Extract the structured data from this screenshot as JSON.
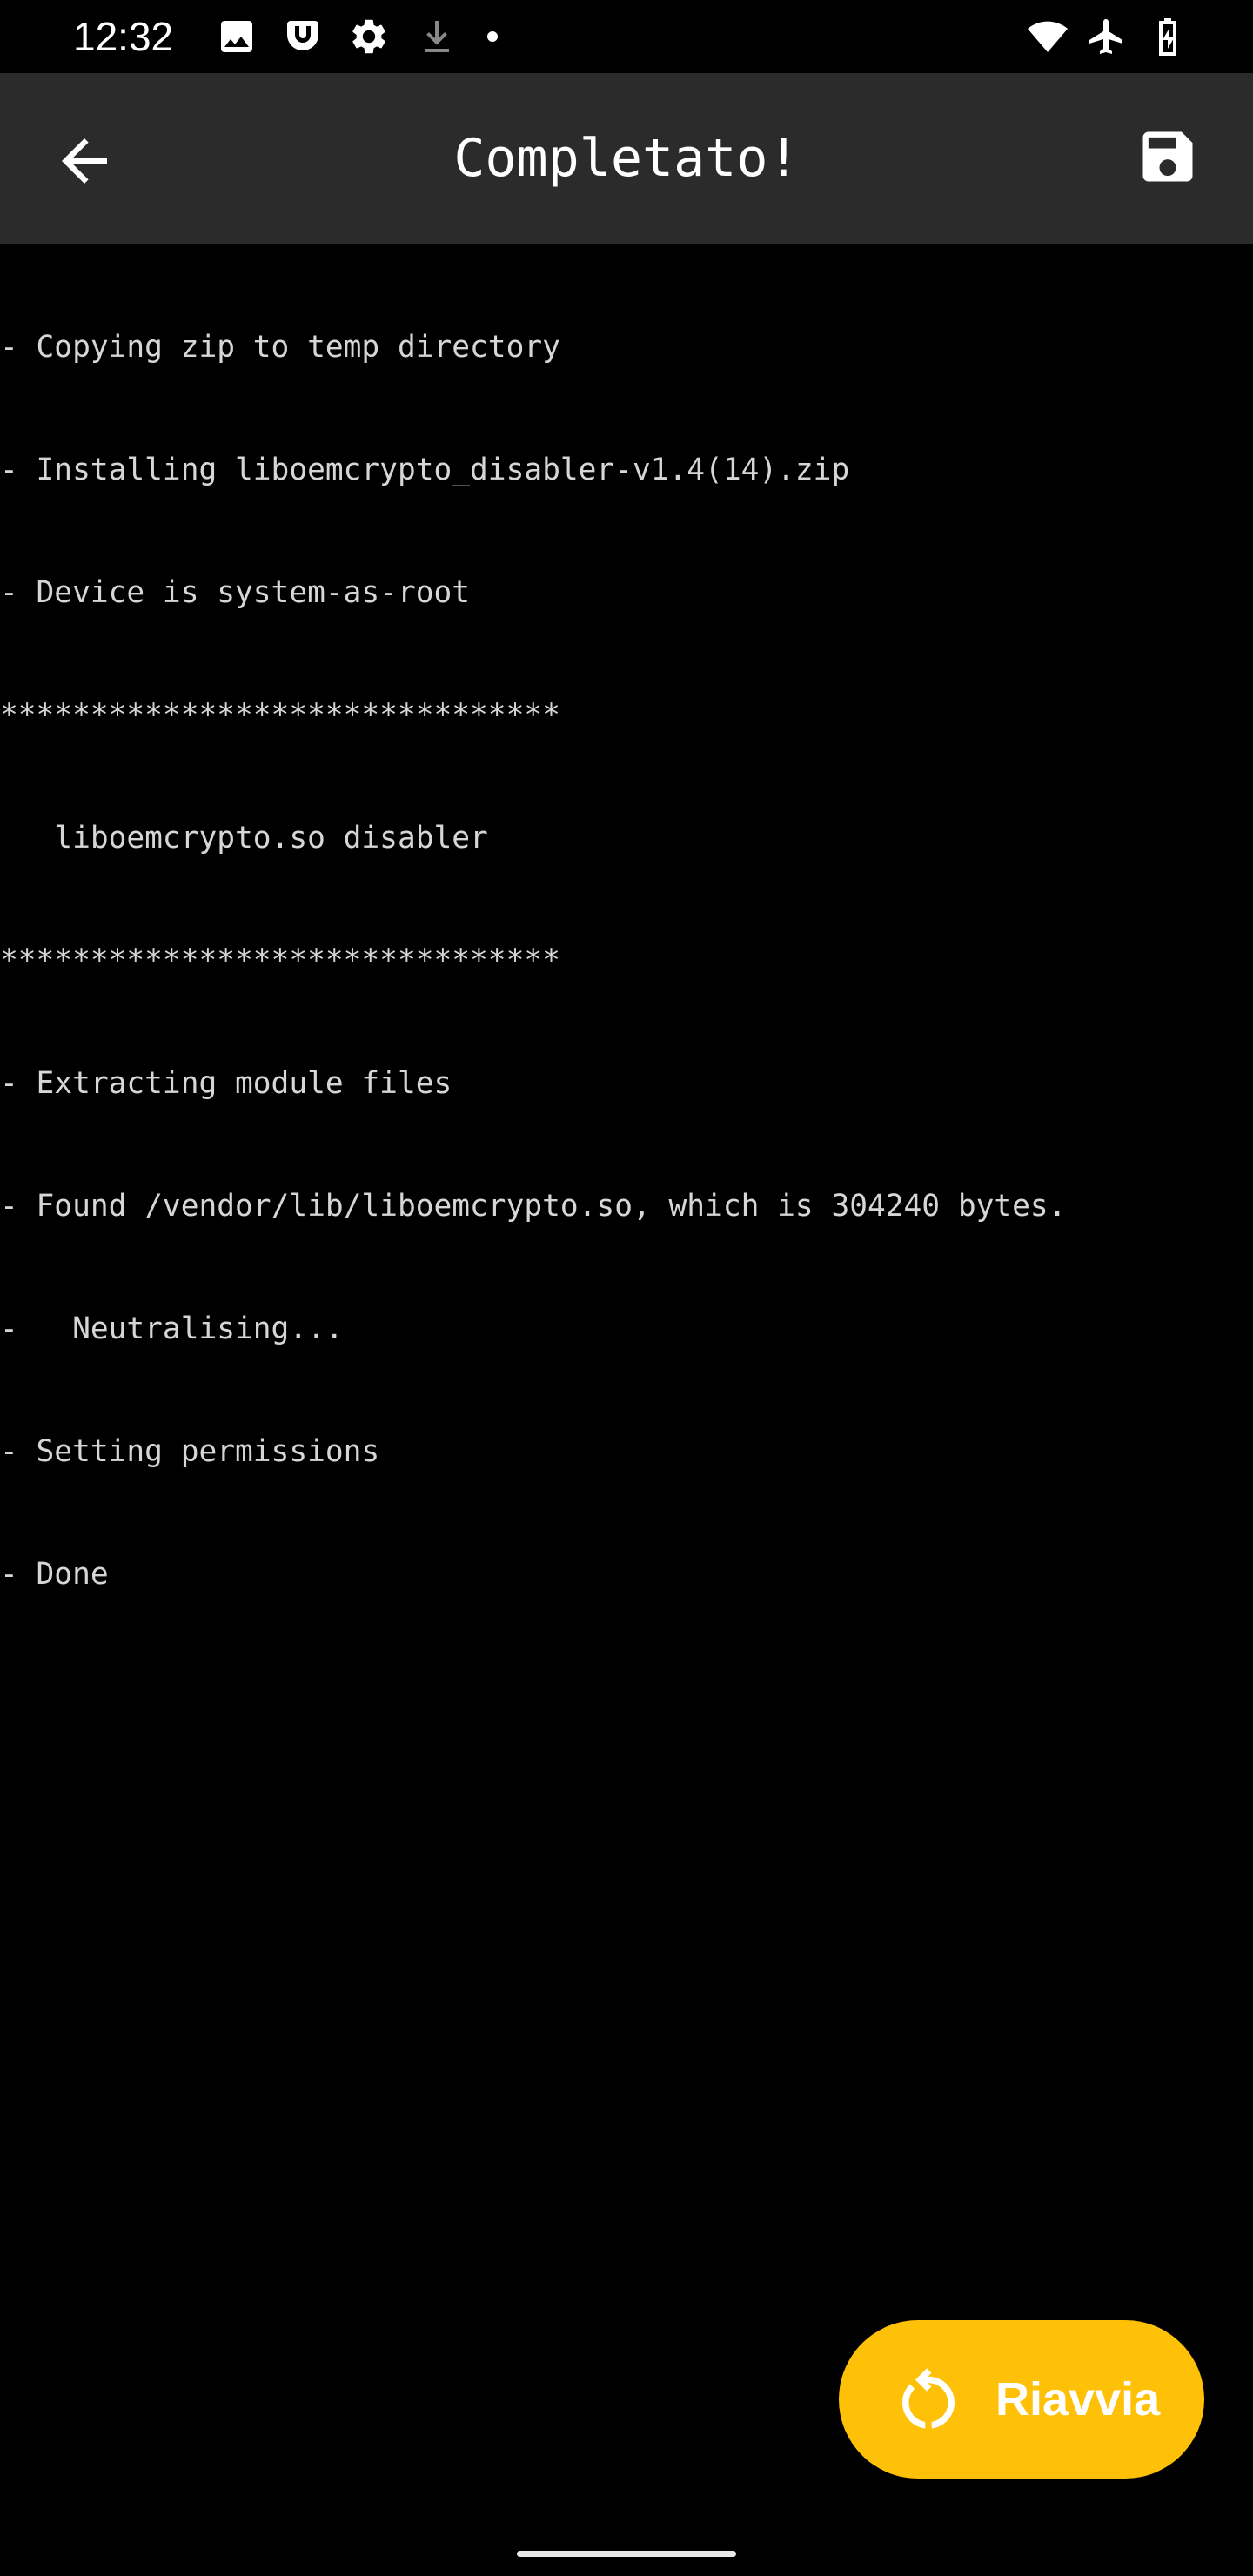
{
  "status_bar": {
    "time": "12:32",
    "icons_left": [
      "image-icon",
      "magisk-icon",
      "gear-icon",
      "download-icon",
      "dot-icon"
    ],
    "icons_right": [
      "wifi-icon",
      "airplane-icon",
      "battery-charging-icon"
    ]
  },
  "toolbar": {
    "title": "Completato!",
    "back_icon": "arrow-back-icon",
    "save_icon": "save-icon"
  },
  "log": {
    "lines": [
      "- Copying zip to temp directory",
      "- Installing liboemcrypto_disabler-v1.4(14).zip",
      "- Device is system-as-root",
      "*******************************",
      "   liboemcrypto.so disabler",
      "*******************************",
      "- Extracting module files",
      "- Found /vendor/lib/liboemcrypto.so, which is 304240 bytes.",
      "-   Neutralising...",
      "- Setting permissions",
      "- Done"
    ]
  },
  "fab": {
    "label": "Riavvia",
    "icon": "restart-icon"
  },
  "colors": {
    "background": "#000000",
    "toolbar": "#2b2b2b",
    "log_text": "#d6d6d6",
    "accent": "#ffc107"
  }
}
